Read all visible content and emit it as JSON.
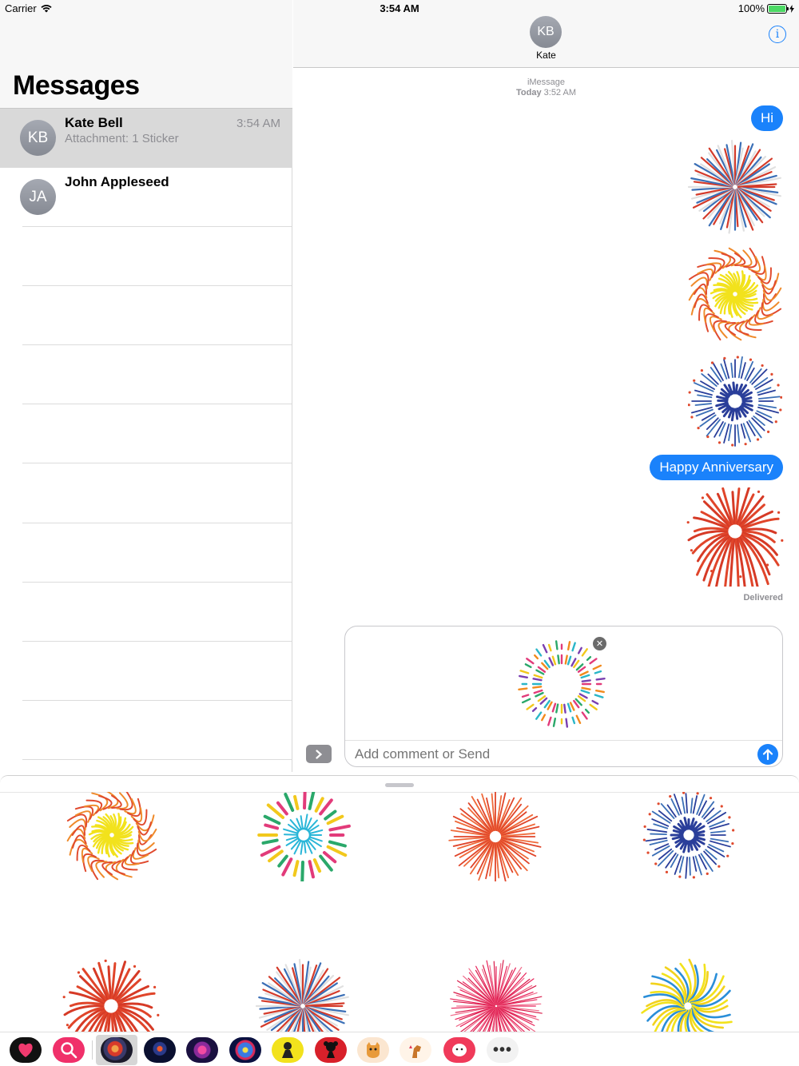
{
  "status_bar": {
    "carrier": "Carrier",
    "time": "3:54 AM",
    "battery": "100%"
  },
  "sidebar": {
    "title": "Messages",
    "conversations": [
      {
        "initials": "KB",
        "name": "Kate Bell",
        "preview": "Attachment: 1 Sticker",
        "time": "3:54 AM"
      },
      {
        "initials": "JA",
        "name": "John Appleseed",
        "preview": "",
        "time": ""
      }
    ]
  },
  "thread": {
    "contact_initials": "KB",
    "contact_name": "Kate",
    "service": "iMessage",
    "day": "Today",
    "day_time": "3:52 AM",
    "messages": [
      {
        "type": "text",
        "text": "Hi"
      },
      {
        "type": "sticker",
        "name": "red-white-blue-firework"
      },
      {
        "type": "sticker",
        "name": "yellow-red-swirl-firework"
      },
      {
        "type": "sticker",
        "name": "blue-ring-firework"
      },
      {
        "type": "text",
        "text": "Happy Anniversary"
      },
      {
        "type": "sticker",
        "name": "red-willow-firework"
      }
    ],
    "delivered": "Delivered"
  },
  "composer": {
    "placeholder": "Add comment or Send",
    "close_glyph": "✕"
  },
  "dock": {
    "more_label": "•••"
  },
  "colors": {
    "accent": "#1a82fb",
    "secondary_text": "#8e8e93",
    "selected_row": "#d9d9d9"
  }
}
